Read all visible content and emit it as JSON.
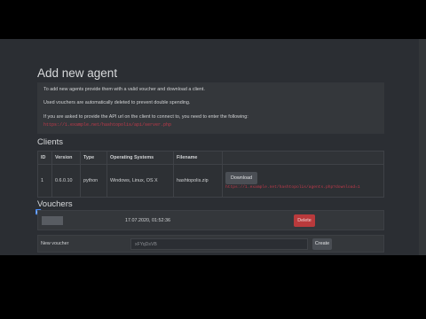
{
  "header": {
    "title": "Add new agent"
  },
  "info": {
    "line1": "To add new agents provide them with a valid voucher and download a client.",
    "line2": "Used vouchers are automatically deleted to prevent double spending.",
    "line3": "If you are asked to provide the API url on the client to connect to, you need to enter the following:",
    "api_url": "https://1.example.net/hashtopolis/api/server.php"
  },
  "clients": {
    "title": "Clients",
    "columns": [
      "ID",
      "Version",
      "Type",
      "Operating Systems",
      "Filename"
    ],
    "rows": [
      {
        "id": "1",
        "version": "0.6.0.10",
        "type": "python",
        "os": "Windows, Linux, OS X",
        "filename": "hashtopolis.zip"
      }
    ],
    "download_label": "Download",
    "download_url": "https://1.example.net/hashtopolis/agents.php?download=1"
  },
  "vouchers": {
    "title": "Vouchers",
    "items": [
      {
        "date": "17.07.2020, 01:52:36",
        "delete_label": "Delete"
      }
    ]
  },
  "new_voucher": {
    "label": "New voucher",
    "value": "xFYqDsVB",
    "create_label": "Create"
  },
  "colors": {
    "background": "#2b2e33",
    "accent_red": "#b93a3c",
    "link_red": "#c0394a"
  }
}
